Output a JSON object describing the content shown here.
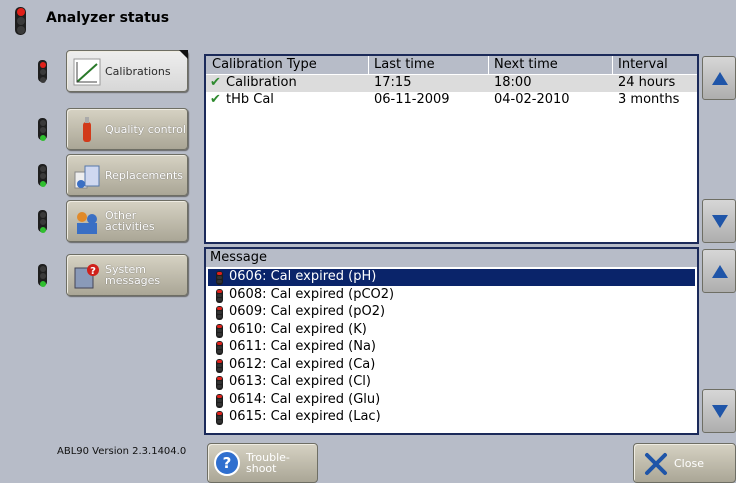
{
  "header": {
    "title": "Analyzer status"
  },
  "nav": [
    {
      "label": "Calibrations",
      "icon": "calibration-graph-icon",
      "status": "red",
      "active": true
    },
    {
      "label": "Quality control",
      "icon": "qc-ampoule-icon",
      "status": "green",
      "active": false
    },
    {
      "label": "Replacements",
      "icon": "replacement-packs-icon",
      "status": "green",
      "active": false
    },
    {
      "label": "Other activities",
      "icon": "other-activities-icon",
      "status": "green",
      "active": false
    },
    {
      "label": "System messages",
      "icon": "system-messages-icon",
      "status": "green",
      "active": false
    }
  ],
  "calibration_table": {
    "columns": [
      "Calibration Type",
      "Last time",
      "Next time",
      "Interval"
    ],
    "rows": [
      {
        "type": "Calibration",
        "last": "17:15",
        "next": "18:00",
        "interval": "24 hours",
        "checked": true,
        "selected": true
      },
      {
        "type": "tHb Cal",
        "last": "06-11-2009",
        "next": "04-02-2010",
        "interval": "3 months",
        "checked": true,
        "selected": false
      }
    ]
  },
  "messages": {
    "header": "Message",
    "items": [
      "0606: Cal expired (pH)",
      "0608: Cal expired (pCO2)",
      "0609: Cal expired (pO2)",
      "0610: Cal expired (K)",
      "0611: Cal expired (Na)",
      "0612: Cal expired (Ca)",
      "0613: Cal expired (Cl)",
      "0614: Cal expired (Glu)",
      "0615: Cal expired (Lac)"
    ],
    "selected_index": 0
  },
  "footer": {
    "version": "ABL90 Version 2.3.1404.0",
    "troubleshoot_label": "Trouble-\nshoot",
    "close_label": "Close"
  },
  "colors": {
    "background": "#b7bcc8",
    "selection": "#0a246a",
    "arrow": "#1f55a8",
    "red_light": "#e0201a",
    "green_light": "#2fbf2f"
  }
}
